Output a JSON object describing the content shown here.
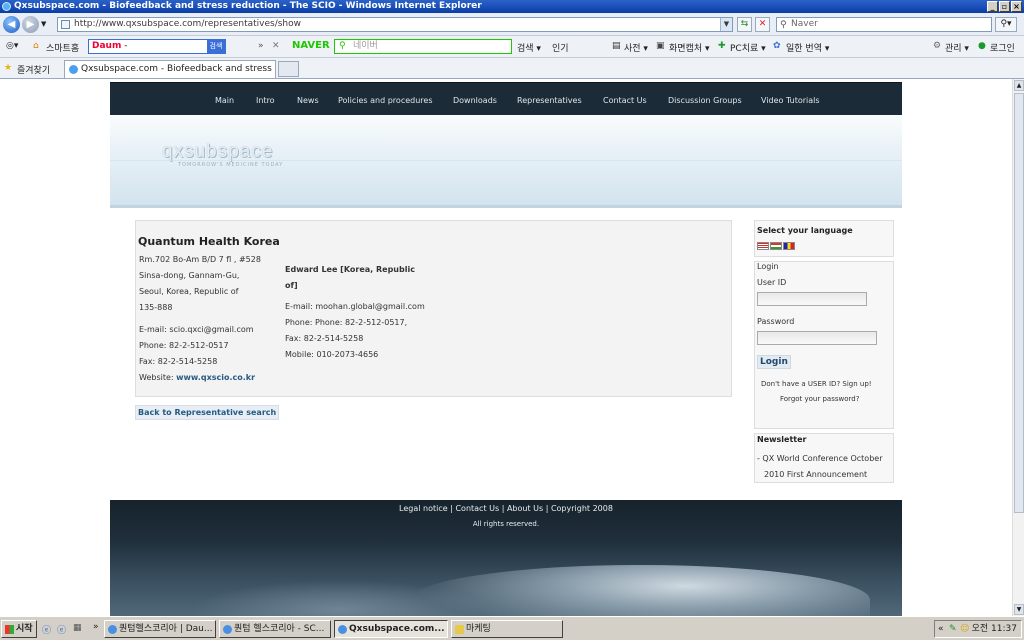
{
  "window": {
    "title": "Qxsubspace.com - Biofeedback and stress reduction - The SCIO - Windows Internet Explorer"
  },
  "browser": {
    "address": "http://www.qxsubspace.com/representatives/show",
    "search_placeholder": "Naver",
    "toolbar": {
      "smart_home": "스마트홈",
      "daum_logo": "Daum",
      "daum_go": "검색",
      "naver_logo": "NAVER",
      "naver_placeholder": "네이버",
      "items": [
        "검색 ▾",
        "인기",
        "사전 ▾",
        "화면캡처 ▾",
        "PC치료 ▾",
        "일한 번역 ▾",
        "관리 ▾",
        "로그인"
      ]
    },
    "favorites_label": "즐겨찾기",
    "tab_title": "Qxsubspace.com - Biofeedback and stress r..."
  },
  "site": {
    "nav": [
      "Main",
      "Intro",
      "News",
      "Policies and procedures",
      "Downloads",
      "Representatives",
      "Contact Us",
      "Discussion Groups",
      "Video Tutorials"
    ],
    "logo": "qxsubspace",
    "tagline": "TOMORROW'S MEDICINE TODAY",
    "company": "Quantum Health Korea",
    "address_lines": [
      "Rm.702 Bo-Am B/D 7 fl , #528",
      "Sinsa-dong, Gannam-Gu,",
      "Seoul, Korea, Republic of",
      "135-888"
    ],
    "contact_lines": [
      "E-mail: scio.qxci@gmail.com",
      "Phone: 82-2-512-0517",
      "Fax: 82-2-514-5258"
    ],
    "website_label": "Website:",
    "website": "www.qxscio.co.kr",
    "person_name": "Edward Lee [Korea, Republic of]",
    "person_lines": [
      "E-mail: moohan.global@gmail.com",
      "Phone: Phone: 82-2-512-0517,",
      "Fax: 82-2-514-5258",
      "Mobile: 010-2073-4656"
    ],
    "back_link": "Back to Representative search",
    "sidebar": {
      "language_title": "Select your language",
      "login_title": "Login",
      "userid_label": "User ID",
      "password_label": "Password",
      "login_button": "Login",
      "no_account": "Don't have a USER ID? Sign up!",
      "forgot": "Forgot your password?",
      "newsletter_title": "Newsletter",
      "newsletter_line1": "- QX World Conference October",
      "newsletter_line2": "2010 First Announcement"
    },
    "footer": {
      "legal": "Legal notice",
      "contact": "Contact Us",
      "about": "About Us",
      "copyright": "Copyright 2008",
      "rights": "All rights reserved."
    }
  },
  "taskbar": {
    "start": "시작",
    "tasks": [
      "퀀텀헬스코리아 | Dau...",
      "퀀텀 헬스코리아 - SC...",
      "Qxsubspace.com...",
      "마케팅"
    ],
    "clock": "오전 11:37"
  }
}
